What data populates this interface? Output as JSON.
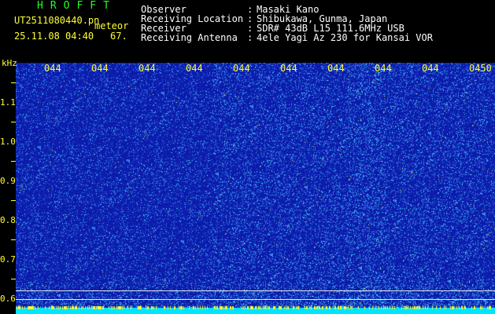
{
  "header": {
    "app_title": "HROFFT",
    "file_name": "UT2511080440.pn",
    "mode": "meteor",
    "timestamp": "25.11.08 04:40",
    "count": "67."
  },
  "info": [
    {
      "label": "Observer",
      "sep": ":",
      "value": "Masaki Kano"
    },
    {
      "label": "Receiving Location",
      "sep": ":",
      "value": "Shibukawa, Gunma, Japan"
    },
    {
      "label": "Receiver",
      "sep": ":",
      "value": "SDR# 43dB L15 111.6MHz USB"
    },
    {
      "label": "Receiving Antenna",
      "sep": ":",
      "value": "4ele Yagi Az 230 for Kansai VOR"
    }
  ],
  "axis": {
    "unit": "kHz",
    "x_ticks": [
      "044",
      "044",
      "044",
      "044",
      "044",
      "044",
      "044",
      "044",
      "044",
      "0450"
    ],
    "y_ticks": [
      "1.1",
      "1.0",
      "0.9",
      "0.8",
      "0.7",
      "0.6"
    ]
  },
  "colors": {
    "background": "#0c1aa8",
    "signal": "#4ec8ff",
    "bright": "#ffff33",
    "text_green": "#21ff21"
  }
}
